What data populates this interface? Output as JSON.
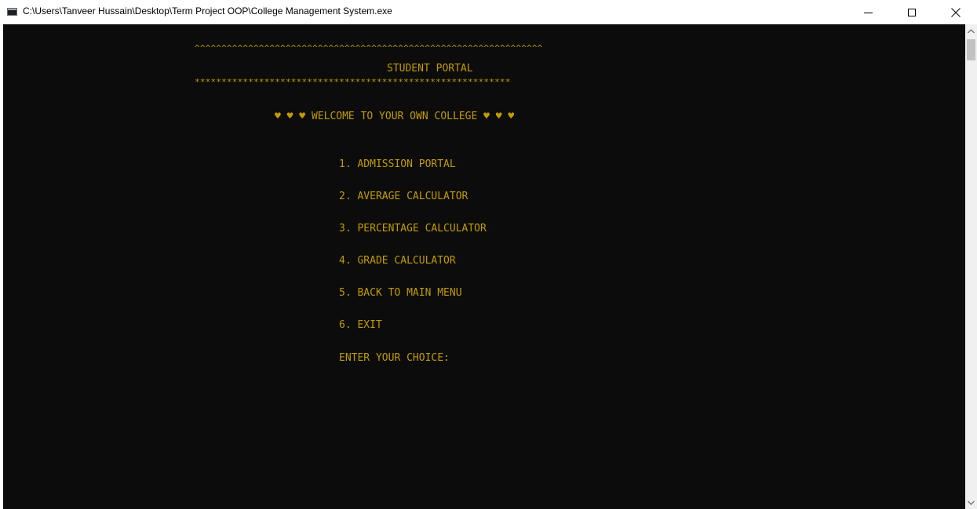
{
  "window": {
    "title": "C:\\Users\\Tanveer Hussain\\Desktop\\Term Project OOP\\College Management System.exe",
    "icon": "console-app-icon",
    "controls": {
      "minimize_icon": "minimize-icon",
      "maximize_icon": "maximize-icon",
      "close_icon": "close-icon"
    }
  },
  "console": {
    "background": "#0c0c0c",
    "text_color": "#c19c00",
    "caret_border": "^^^^^^^^^^^^^^^^^^^^^^^^^^^^^^^^^^^^^^^^^^^^^^^^^^^^^^^^^^^^^^^^^",
    "title": "STUDENT PORTAL",
    "star_border": "***********************************************************",
    "welcome": "♥ ♥ ♥ WELCOME TO YOUR OWN COLLEGE ♥ ♥ ♥",
    "menu": [
      "1. ADMISSION PORTAL",
      "2. AVERAGE CALCULATOR",
      "3. PERCENTAGE CALCULATOR",
      "4. GRADE CALCULATOR",
      "5. BACK TO MAIN MENU",
      "6. EXIT"
    ],
    "prompt": "ENTER YOUR CHOICE:"
  },
  "scrollbar": {
    "up_icon": "scroll-up-arrow-icon",
    "down_icon": "scroll-down-arrow-icon"
  }
}
